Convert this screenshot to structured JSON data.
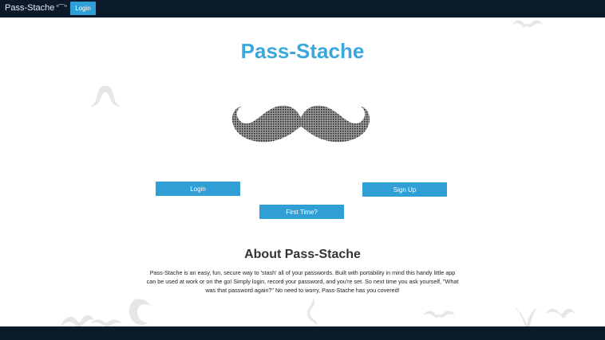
{
  "navbar": {
    "brand": "Pass-Stache",
    "brand_mini": "\"⁀\"",
    "login_label": "Login"
  },
  "hero": {
    "title": "Pass-Stache"
  },
  "actions": {
    "login_label": "Login",
    "signup_label": "Sign Up",
    "first_time_label": "First Time?"
  },
  "about": {
    "heading": "About Pass-Stache",
    "text": "Pass-Stache is an easy, fun, secure way to 'stash' all of your passwords. Built with portability in mind this handy little app can be used at work or on the go! Simply login, record your password, and you're set. So next time you ask yourself, \"What was that password again?\" No need to worry, Pass-Stache has you covered!"
  },
  "colors": {
    "navbar": "#0b1a2b",
    "accent": "#2f9fd6",
    "title": "#3aa7dd"
  }
}
